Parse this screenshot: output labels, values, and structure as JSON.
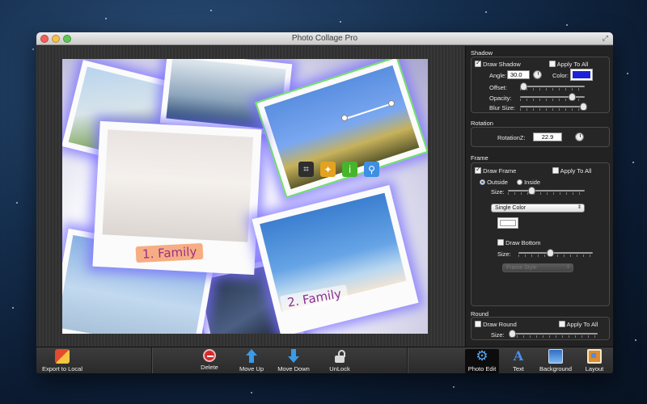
{
  "window": {
    "title": "Photo Collage Pro"
  },
  "canvas": {
    "captions": [
      "1. Family",
      "2. Family"
    ]
  },
  "panel": {
    "shadow": {
      "title": "Shadow",
      "draw_shadow_label": "Draw Shadow",
      "draw_shadow_checked": true,
      "apply_all_label": "Apply To All",
      "apply_all_checked": false,
      "angle_label": "Angle:",
      "angle_value": "30.0",
      "color_label": "Color:",
      "color_value": "#1a22d8",
      "offset_label": "Offset:",
      "offset_value": 0.05,
      "opacity_label": "Opacity:",
      "opacity_value": 0.8,
      "blur_label": "Blur Size:",
      "blur_value": 0.97
    },
    "rotation": {
      "title": "Rotation",
      "rotationz_label": "RotationZ:",
      "rotationz_value": "22.9"
    },
    "frame": {
      "title": "Frame",
      "draw_frame_label": "Draw Frame",
      "draw_frame_checked": true,
      "apply_all_label": "Apply To All",
      "apply_all_checked": false,
      "outside_label": "Outside",
      "inside_label": "Inside",
      "selected_position": "Outside",
      "size_label": "Size:",
      "size_value": 0.3,
      "color_mode": "Single Color",
      "frame_color": "#ffffff",
      "draw_bottom_label": "Draw Bottom",
      "draw_bottom_checked": false,
      "bottom_size_label": "Size:",
      "bottom_size_value": 0.42,
      "frame_style_label": "Frame Style"
    },
    "round": {
      "title": "Round",
      "draw_round_label": "Draw Round",
      "draw_round_checked": false,
      "apply_all_label": "Apply To All",
      "apply_all_checked": false,
      "size_label": "Size:",
      "size_value": 0.02
    }
  },
  "toolbar": {
    "export_label": "Export to Local",
    "delete_label": "Delete",
    "move_up_label": "Move Up",
    "move_down_label": "Move Down",
    "unlock_label": "UnLock",
    "photo_edit_label": "Photo Edit",
    "text_label": "Text",
    "background_label": "Background",
    "layout_label": "Layout",
    "active_tab": "Photo Edit"
  }
}
